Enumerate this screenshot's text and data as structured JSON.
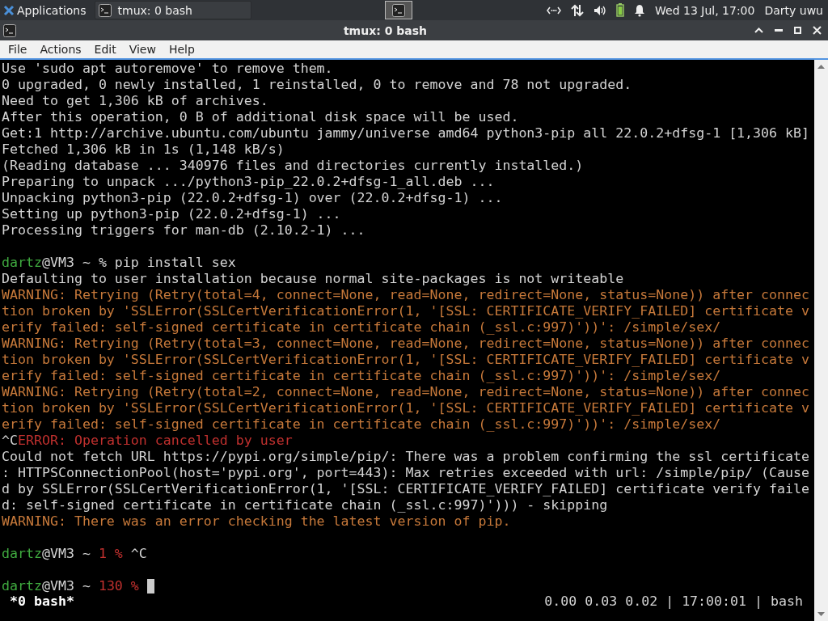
{
  "panel": {
    "applications": "Applications",
    "tasks": [
      {
        "label": "tmux: 0 bash",
        "selected": false
      }
    ],
    "clock": "Wed 13 Jul, 17:00",
    "user": "Darty uwu"
  },
  "window": {
    "title": "tmux: 0 bash"
  },
  "menu": [
    "File",
    "Actions",
    "Edit",
    "View",
    "Help"
  ],
  "terminal": {
    "lines": [
      {
        "segments": [
          {
            "kind": "normal",
            "text": "Use 'sudo apt autoremove' to remove them."
          }
        ]
      },
      {
        "segments": [
          {
            "kind": "normal",
            "text": "0 upgraded, 0 newly installed, 1 reinstalled, 0 to remove and 78 not upgraded."
          }
        ]
      },
      {
        "segments": [
          {
            "kind": "normal",
            "text": "Need to get 1,306 kB of archives."
          }
        ]
      },
      {
        "segments": [
          {
            "kind": "normal",
            "text": "After this operation, 0 B of additional disk space will be used."
          }
        ]
      },
      {
        "segments": [
          {
            "kind": "normal",
            "text": "Get:1 http://archive.ubuntu.com/ubuntu jammy/universe amd64 python3-pip all 22.0.2+dfsg-1 [1,306 kB]"
          }
        ]
      },
      {
        "segments": [
          {
            "kind": "normal",
            "text": "Fetched 1,306 kB in 1s (1,148 kB/s)"
          }
        ]
      },
      {
        "segments": [
          {
            "kind": "normal",
            "text": "(Reading database ... 340976 files and directories currently installed.)"
          }
        ]
      },
      {
        "segments": [
          {
            "kind": "normal",
            "text": "Preparing to unpack .../python3-pip_22.0.2+dfsg-1_all.deb ..."
          }
        ]
      },
      {
        "segments": [
          {
            "kind": "normal",
            "text": "Unpacking python3-pip (22.0.2+dfsg-1) over (22.0.2+dfsg-1) ..."
          }
        ]
      },
      {
        "segments": [
          {
            "kind": "normal",
            "text": "Setting up python3-pip (22.0.2+dfsg-1) ..."
          }
        ]
      },
      {
        "segments": [
          {
            "kind": "normal",
            "text": "Processing triggers for man-db (2.10.2-1) ..."
          }
        ]
      },
      {
        "spaced": true,
        "segments": [
          {
            "kind": "user",
            "text": "dartz"
          },
          {
            "kind": "normal",
            "text": "@VM3 ~ % pip install sex"
          }
        ]
      },
      {
        "segments": [
          {
            "kind": "normal",
            "text": "Defaulting to user installation because normal site-packages is not writeable"
          }
        ]
      },
      {
        "segments": [
          {
            "kind": "warning",
            "text": "WARNING: Retrying (Retry(total=4, connect=None, read=None, redirect=None, status=None)) after connec"
          }
        ]
      },
      {
        "segments": [
          {
            "kind": "warning",
            "text": "tion broken by 'SSLError(SSLCertVerificationError(1, '[SSL: CERTIFICATE_VERIFY_FAILED] certificate v"
          }
        ]
      },
      {
        "segments": [
          {
            "kind": "warning",
            "text": "erify failed: self-signed certificate in certificate chain (_ssl.c:997)'))': /simple/sex/"
          }
        ]
      },
      {
        "segments": [
          {
            "kind": "warning",
            "text": "WARNING: Retrying (Retry(total=3, connect=None, read=None, redirect=None, status=None)) after connec"
          }
        ]
      },
      {
        "segments": [
          {
            "kind": "warning",
            "text": "tion broken by 'SSLError(SSLCertVerificationError(1, '[SSL: CERTIFICATE_VERIFY_FAILED] certificate v"
          }
        ]
      },
      {
        "segments": [
          {
            "kind": "warning",
            "text": "erify failed: self-signed certificate in certificate chain (_ssl.c:997)'))': /simple/sex/"
          }
        ]
      },
      {
        "segments": [
          {
            "kind": "warning",
            "text": "WARNING: Retrying (Retry(total=2, connect=None, read=None, redirect=None, status=None)) after connec"
          }
        ]
      },
      {
        "segments": [
          {
            "kind": "warning",
            "text": "tion broken by 'SSLError(SSLCertVerificationError(1, '[SSL: CERTIFICATE_VERIFY_FAILED] certificate v"
          }
        ]
      },
      {
        "segments": [
          {
            "kind": "warning",
            "text": "erify failed: self-signed certificate in certificate chain (_ssl.c:997)'))': /simple/sex/"
          }
        ]
      },
      {
        "segments": [
          {
            "kind": "normal",
            "text": "^C"
          },
          {
            "kind": "error",
            "text": "ERROR: Operation cancelled by user"
          }
        ]
      },
      {
        "segments": [
          {
            "kind": "normal",
            "text": "Could not fetch URL https://pypi.org/simple/pip/: There was a problem confirming the ssl certificate"
          }
        ]
      },
      {
        "segments": [
          {
            "kind": "normal",
            "text": ": HTTPSConnectionPool(host='pypi.org', port=443): Max retries exceeded with url: /simple/pip/ (Cause"
          }
        ]
      },
      {
        "segments": [
          {
            "kind": "normal",
            "text": "d by SSLError(SSLCertVerificationError(1, '[SSL: CERTIFICATE_VERIFY_FAILED] certificate verify faile"
          }
        ]
      },
      {
        "segments": [
          {
            "kind": "normal",
            "text": "d: self-signed certificate in certificate chain (_ssl.c:997)'))) - skipping"
          }
        ]
      },
      {
        "segments": [
          {
            "kind": "warning",
            "text": "WARNING: There was an error checking the latest version of pip."
          }
        ]
      },
      {
        "spaced": true,
        "segments": [
          {
            "kind": "user",
            "text": "dartz"
          },
          {
            "kind": "normal",
            "text": "@VM3 ~ "
          },
          {
            "kind": "error",
            "text": "1 %"
          },
          {
            "kind": "normal",
            "text": " ^C"
          }
        ]
      },
      {
        "spaced": true,
        "cursor": true,
        "segments": [
          {
            "kind": "user",
            "text": "dartz"
          },
          {
            "kind": "normal",
            "text": "@VM3 ~ "
          },
          {
            "kind": "error",
            "text": "130 %"
          }
        ]
      }
    ]
  },
  "status": {
    "window": "*0 bash*",
    "info": "0.00 0.03 0.02 | 17:00:01 | bash"
  }
}
